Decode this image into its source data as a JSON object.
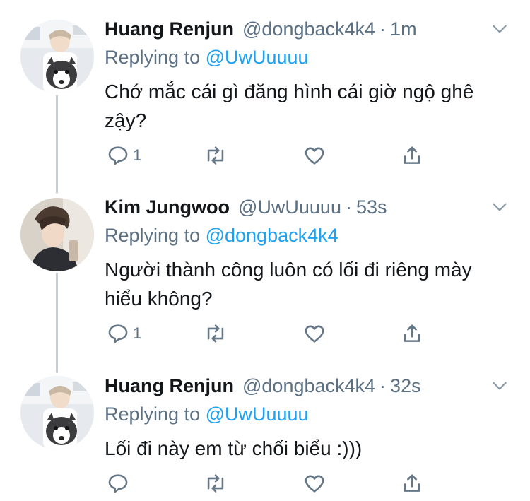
{
  "colors": {
    "accent": "#1da1f2",
    "muted": "#5b7083",
    "text": "#14171a",
    "thread_line": "#c4cfd6"
  },
  "tweets": [
    {
      "name": "Huang Renjun",
      "handle": "@dongback4k4",
      "separator": "·",
      "time": "1m",
      "replying_prefix": "Replying to ",
      "replying_to": "@UwUuuuu",
      "text": "Chớ mắc cái gì đăng hình cái giờ ngộ ghê zậy?",
      "reply_count": "1",
      "avatar": "avatar-renjun-with-husky"
    },
    {
      "name": "Kim Jungwoo",
      "handle": "@UwUuuuu",
      "separator": "·",
      "time": "53s",
      "replying_prefix": "Replying to ",
      "replying_to": "@dongback4k4",
      "text": "Người thành công luôn có lối đi riêng mày hiểu không?",
      "reply_count": "1",
      "avatar": "avatar-jungwoo"
    },
    {
      "name": "Huang Renjun",
      "handle": "@dongback4k4",
      "separator": "·",
      "time": "32s",
      "replying_prefix": "Replying to ",
      "replying_to": "@UwUuuuu",
      "text": "Lối đi này em từ chối biểu :)))",
      "reply_count": "",
      "avatar": "avatar-renjun-with-husky"
    }
  ],
  "icons": {
    "more": "chevron-down-icon",
    "reply": "reply-icon",
    "retweet": "retweet-icon",
    "like": "heart-icon",
    "share": "share-icon"
  }
}
